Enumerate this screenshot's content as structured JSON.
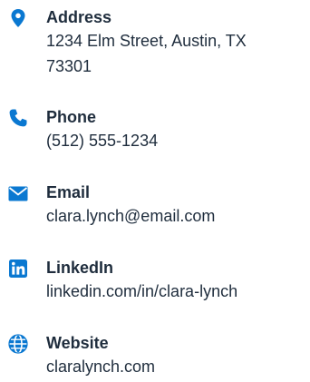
{
  "colors": {
    "accent": "#0a78d1",
    "text": "#1f2d3d",
    "background": "#ffffff"
  },
  "contact": {
    "address": {
      "icon": "map-pin-icon",
      "label": "Address",
      "value_line1": "1234 Elm Street, Austin, TX",
      "value_line2": "73301"
    },
    "phone": {
      "icon": "phone-icon",
      "label": "Phone",
      "value": "(512) 555-1234"
    },
    "email": {
      "icon": "envelope-icon",
      "label": "Email",
      "value": "clara.lynch@email.com"
    },
    "linkedin": {
      "icon": "linkedin-icon",
      "label": "LinkedIn",
      "value": "linkedin.com/in/clara-lynch"
    },
    "website": {
      "icon": "globe-icon",
      "label": "Website",
      "value": "claralynch.com"
    }
  }
}
